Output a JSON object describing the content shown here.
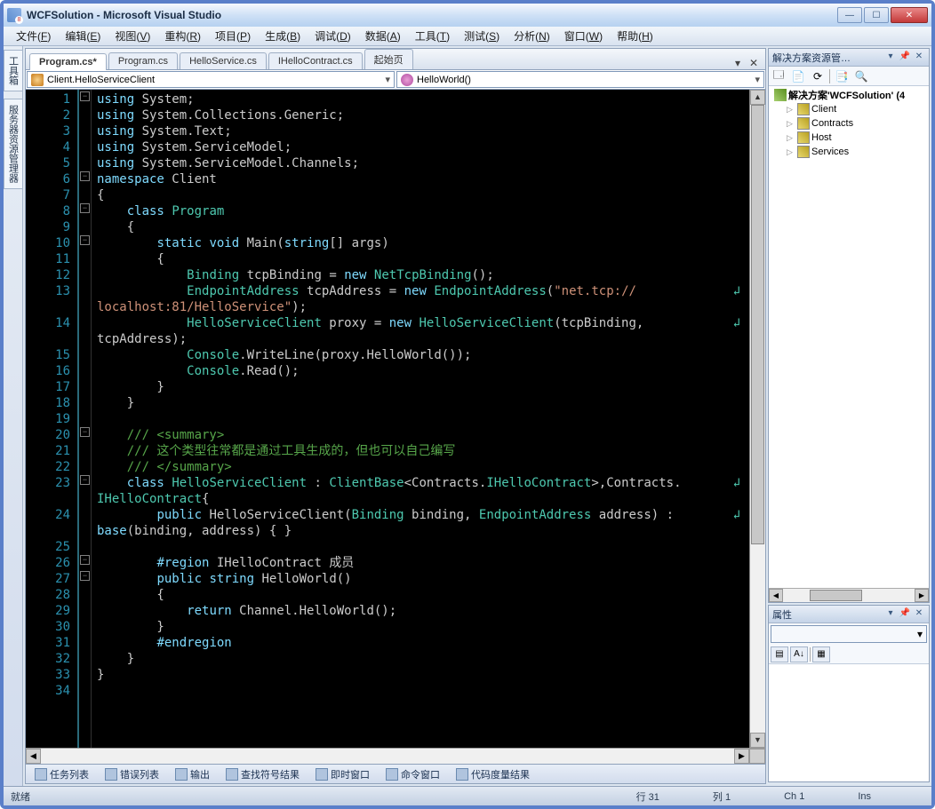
{
  "window": {
    "title": "WCFSolution - Microsoft Visual Studio"
  },
  "menu": [
    {
      "label": "文件(F)",
      "u": "F"
    },
    {
      "label": "编辑(E)",
      "u": "E"
    },
    {
      "label": "视图(V)",
      "u": "V"
    },
    {
      "label": "重构(R)",
      "u": "R"
    },
    {
      "label": "项目(P)",
      "u": "P"
    },
    {
      "label": "生成(B)",
      "u": "B"
    },
    {
      "label": "调试(D)",
      "u": "D"
    },
    {
      "label": "数据(A)",
      "u": "A"
    },
    {
      "label": "工具(T)",
      "u": "T"
    },
    {
      "label": "测试(S)",
      "u": "S"
    },
    {
      "label": "分析(N)",
      "u": "N"
    },
    {
      "label": "窗口(W)",
      "u": "W"
    },
    {
      "label": "帮助(H)",
      "u": "H"
    }
  ],
  "left_tabs": [
    "工具箱",
    "服务器资源管理器"
  ],
  "editor_tabs": [
    {
      "label": "Program.cs*",
      "active": true
    },
    {
      "label": "Program.cs",
      "active": false
    },
    {
      "label": "HelloService.cs",
      "active": false
    },
    {
      "label": "IHelloContract.cs",
      "active": false
    },
    {
      "label": "起始页",
      "active": false
    }
  ],
  "combo_left": "Client.HelloServiceClient",
  "combo_right": "HelloWorld()",
  "code_lines": [
    {
      "n": 1,
      "html": "<span class='kw'>using</span> System;"
    },
    {
      "n": 2,
      "html": "<span class='kw'>using</span> System.Collections.Generic;"
    },
    {
      "n": 3,
      "html": "<span class='kw'>using</span> System.Text;"
    },
    {
      "n": 4,
      "html": "<span class='kw'>using</span> System.ServiceModel;"
    },
    {
      "n": 5,
      "html": "<span class='kw'>using</span> System.ServiceModel.Channels;"
    },
    {
      "n": 6,
      "html": "<span class='kw'>namespace</span> Client"
    },
    {
      "n": 7,
      "html": "{"
    },
    {
      "n": 8,
      "html": "    <span class='kw'>class</span> <span class='cls'>Program</span>"
    },
    {
      "n": 9,
      "html": "    {"
    },
    {
      "n": 10,
      "html": "        <span class='kw'>static</span> <span class='kw'>void</span> Main(<span class='kw'>string</span>[] args)"
    },
    {
      "n": 11,
      "html": "        {"
    },
    {
      "n": 12,
      "html": "            <span class='cls'>Binding</span> tcpBinding = <span class='kw'>new</span> <span class='cls'>NetTcpBinding</span>();"
    },
    {
      "n": 13,
      "html": "            <span class='cls'>EndpointAddress</span> tcpAddress = <span class='kw'>new</span> <span class='cls'>EndpointAddress</span>(<span class='str'>\"net.tcp://</span><span class='wrap-glyph'>↲</span>"
    },
    {
      "n": "",
      "html": "<span class='str'>localhost:81/HelloService\"</span>);"
    },
    {
      "n": 14,
      "html": "            <span class='cls'>HelloServiceClient</span> proxy = <span class='kw'>new</span> <span class='cls'>HelloServiceClient</span>(tcpBinding, <span class='wrap-glyph'>↲</span>"
    },
    {
      "n": "",
      "html": "tcpAddress);"
    },
    {
      "n": 15,
      "html": "            <span class='cls'>Console</span>.WriteLine(proxy.HelloWorld());"
    },
    {
      "n": 16,
      "html": "            <span class='cls'>Console</span>.Read();"
    },
    {
      "n": 17,
      "html": "        }"
    },
    {
      "n": 18,
      "html": "    }"
    },
    {
      "n": 19,
      "html": ""
    },
    {
      "n": 20,
      "html": "    <span class='com'>/// &lt;summary&gt;</span>"
    },
    {
      "n": 21,
      "html": "    <span class='com'>/// 这个类型往常都是通过工具生成的，但也可以自己编写</span>"
    },
    {
      "n": 22,
      "html": "    <span class='com'>/// &lt;/summary&gt;</span>"
    },
    {
      "n": 23,
      "html": "    <span class='kw'>class</span> <span class='cls'>HelloServiceClient</span> : <span class='cls'>ClientBase</span>&lt;Contracts.<span class='cls'>IHelloContract</span>&gt;,Contracts.<span class='wrap-glyph'>↲</span>"
    },
    {
      "n": "",
      "html": "<span class='cls'>IHelloContract</span>{"
    },
    {
      "n": 24,
      "html": "        <span class='kw'>public</span> HelloServiceClient(<span class='cls'>Binding</span> binding, <span class='cls'>EndpointAddress</span> address) : <span class='wrap-glyph'>↲</span>"
    },
    {
      "n": "",
      "html": "<span class='kw'>base</span>(binding, address) { }"
    },
    {
      "n": 25,
      "html": ""
    },
    {
      "n": 26,
      "html": "        <span class='kw'>#region</span> IHelloContract 成员"
    },
    {
      "n": 27,
      "html": "        <span class='kw'>public</span> <span class='kw'>string</span> HelloWorld()"
    },
    {
      "n": 28,
      "html": "        {"
    },
    {
      "n": 29,
      "html": "            <span class='kw'>return</span> Channel.HelloWorld();"
    },
    {
      "n": 30,
      "html": "        }"
    },
    {
      "n": 31,
      "html": "        <span class='kw'>#endregion</span>"
    },
    {
      "n": 32,
      "html": "    }"
    },
    {
      "n": 33,
      "html": "}"
    },
    {
      "n": 34,
      "html": ""
    }
  ],
  "outline_markers": [
    1,
    6,
    8,
    10,
    20,
    23,
    26,
    27
  ],
  "solution_explorer": {
    "title": "解决方案资源管…",
    "root": "解决方案'WCFSolution' (4",
    "projects": [
      "Client",
      "Contracts",
      "Host",
      "Services"
    ]
  },
  "properties_pane": {
    "title": "属性"
  },
  "bottom_tabs": [
    "任务列表",
    "错误列表",
    "输出",
    "查找符号结果",
    "即时窗口",
    "命令窗口",
    "代码度量结果"
  ],
  "status": {
    "ready": "就绪",
    "line_label": "行",
    "line": "31",
    "col_label": "列",
    "col": "1",
    "ch_label": "Ch",
    "ch": "1",
    "ins": "Ins"
  }
}
